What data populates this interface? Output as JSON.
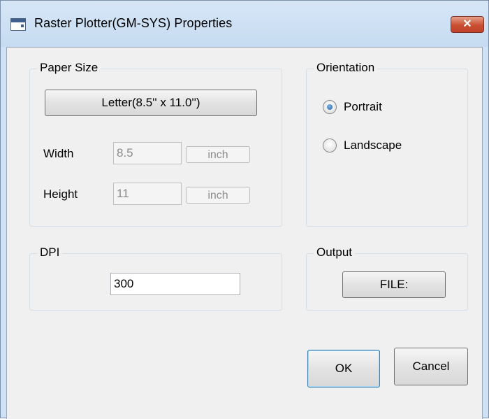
{
  "window": {
    "title": "Raster Plotter(GM-SYS) Properties",
    "close_glyph": "✕"
  },
  "paper_size": {
    "label": "Paper Size",
    "size_button": "Letter(8.5'' x 11.0'')",
    "width_label": "Width",
    "width_value": "8.5",
    "width_unit": "inch",
    "height_label": "Height",
    "height_value": "11",
    "height_unit": "inch"
  },
  "orientation": {
    "label": "Orientation",
    "options": [
      {
        "label": "Portrait",
        "selected": true
      },
      {
        "label": "Landscape",
        "selected": false
      }
    ]
  },
  "dpi": {
    "label": "DPI",
    "value": "300"
  },
  "output": {
    "label": "Output",
    "button": "FILE:"
  },
  "actions": {
    "ok": "OK",
    "cancel": "Cancel"
  },
  "colors": {
    "title_bar": "#cfe1f5",
    "close_button": "#c94f31",
    "dialog_background": "#f0f0f0",
    "default_button_border": "#3c7fb1"
  },
  "icons": {
    "app": "window-app-icon",
    "close": "close-icon"
  }
}
